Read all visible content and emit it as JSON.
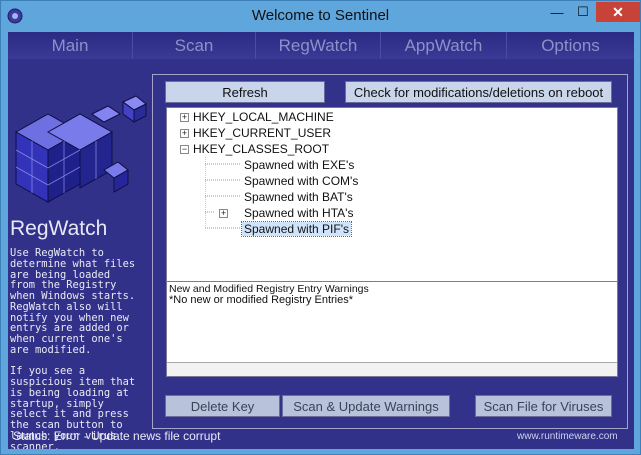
{
  "window": {
    "title": "Welcome to Sentinel",
    "min_glyph": "—",
    "max_glyph": "☐",
    "close_glyph": "✕"
  },
  "menu": {
    "items": [
      {
        "label": "Main"
      },
      {
        "label": "Scan"
      },
      {
        "label": "RegWatch"
      },
      {
        "label": "AppWatch"
      },
      {
        "label": "Options"
      }
    ]
  },
  "sidebar": {
    "title": "RegWatch",
    "description": "Use RegWatch to\ndetermine what files\nare being loaded\nfrom the Registry\nwhen Windows starts.\nRegWatch also will\nnotify you when new\nentrys are added or\nwhen current one's\nare modified.\n\nIf you see a\nsuspicious item that\nis being loading at\nstartup, simply\nselect it and press\nthe scan button to\nlaunch your virus\nscanner."
  },
  "toolbar": {
    "refresh_label": "Refresh",
    "check_label": "Check for modifications/deletions on reboot"
  },
  "tree": {
    "nodes": [
      {
        "label": "HKEY_LOCAL_MACHINE",
        "expander": "+"
      },
      {
        "label": "HKEY_CURRENT_USER",
        "expander": "+"
      },
      {
        "label": "HKEY_CLASSES_ROOT",
        "expander": "−"
      },
      {
        "label": "Spawned with EXE's"
      },
      {
        "label": "Spawned with COM's"
      },
      {
        "label": "Spawned with BAT's"
      },
      {
        "label": "Spawned with HTA's",
        "expander": "+"
      },
      {
        "label": "Spawned with PIF's",
        "selected": true
      }
    ]
  },
  "warnings": {
    "title": "New and Modified Registry Entry Warnings",
    "text": "*No new or modified Registry Entries*"
  },
  "actions": {
    "delete_label": "Delete Key",
    "scan_update_label": "Scan & Update Warnings",
    "scan_file_label": "Scan File for Viruses"
  },
  "status": {
    "text": "Status: Error - Update news file corrupt"
  },
  "watermark": "www.runtimeware.com",
  "colors": {
    "window_frame": "#5fa6dc",
    "client_bg": "#31318a",
    "menu_text": "#8e90c8",
    "close_button": "#c7433a",
    "button_bg": "#c9d5ea"
  }
}
